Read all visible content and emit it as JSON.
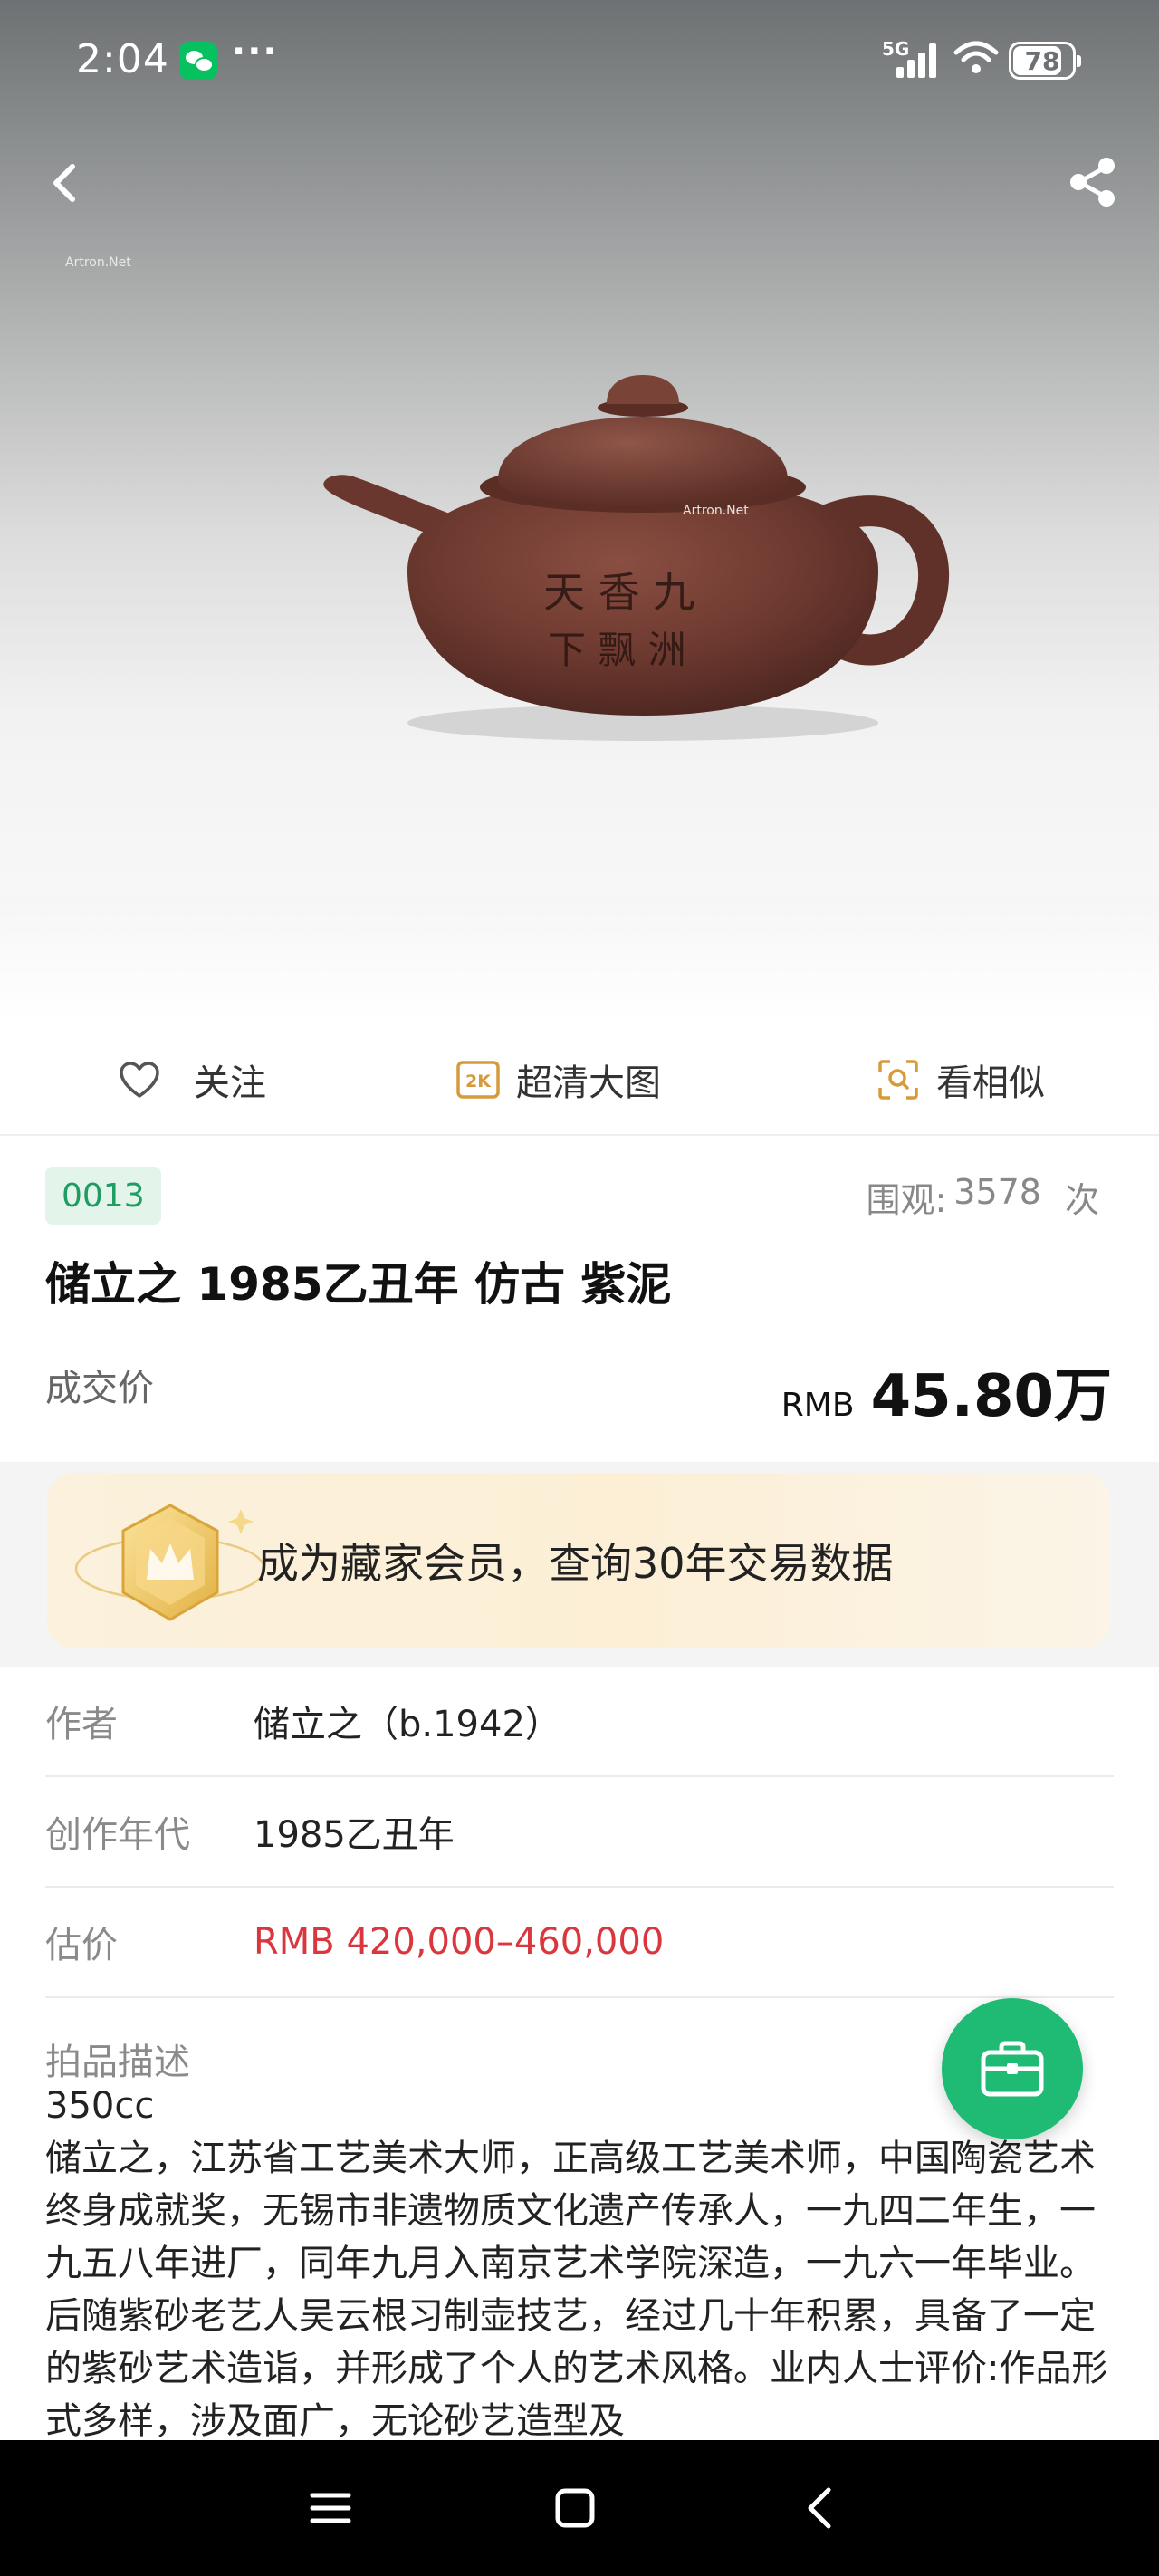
{
  "status_bar": {
    "time": "2:04",
    "more": "···",
    "network": "5G",
    "battery": "78"
  },
  "hero": {
    "watermark": "Artron.Net",
    "inscription": "天香九洲 下飘"
  },
  "actions": {
    "follow": "关注",
    "hd_badge": "2K",
    "hd": "超清大图",
    "similar": "看相似"
  },
  "lot": {
    "number": "0013",
    "views_label": "围观:",
    "views": "3578",
    "views_unit": "次",
    "title": "储立之 1985乙丑年 仿古 紫泥",
    "price_label": "成交价",
    "currency": "RMB",
    "price": "45.80万"
  },
  "member_banner": {
    "text": "成为藏家会员，查询30年交易数据"
  },
  "details": {
    "rows": [
      {
        "label": "作者",
        "value": "储立之（b.1942）"
      },
      {
        "label": "创作年代",
        "value": "1985乙丑年"
      },
      {
        "label": "估价",
        "value": "RMB  420,000–460,000"
      }
    ],
    "description_label": "拍品描述",
    "description": "350cc\n储立之，江苏省工艺美术大师，正高级工艺美术师，中国陶瓷艺术终身成就奖，无锡市非遗物质文化遗产传承人，一九四二年生，一九五八年进厂，同年九月入南京艺术学院深造，一九六一年毕业。后随紫砂老艺人吴云根习制壶技艺，经过几十年积累，具备了一定的紫砂艺术造诣，并形成了个人的艺术风格。业内人士评价:作品形式多样，涉及面广，无论砂艺造型及"
  },
  "colors": {
    "accent_green": "#1fba73",
    "estimate_red": "#d9363e",
    "badge_green": "#1e9d62"
  },
  "icons": [
    "back-icon",
    "share-icon",
    "heart-icon",
    "hd-icon",
    "scan-similar-icon",
    "crown-icon",
    "briefcase-icon",
    "menu-icon",
    "home-icon",
    "nav-back-icon"
  ]
}
